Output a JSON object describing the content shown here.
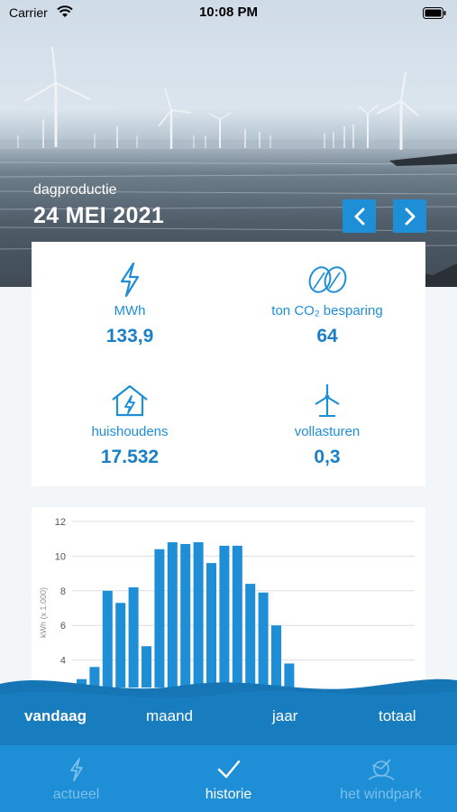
{
  "status_bar": {
    "carrier": "Carrier",
    "time": "10:08 PM"
  },
  "header": {
    "label": "dagproductie",
    "date": "24 MEI 2021"
  },
  "stats": [
    {
      "icon": "lightning-icon",
      "label": "MWh",
      "value": "133,9"
    },
    {
      "icon": "leaves-icon",
      "label": "ton CO₂ besparing",
      "value": "64"
    },
    {
      "icon": "house-icon",
      "label": "huishoudens",
      "value": "17.532"
    },
    {
      "icon": "wind-turbine-icon",
      "label": "vollasturen",
      "value": "0,3"
    }
  ],
  "chart_data": {
    "type": "bar",
    "ylabel": "kWh (x 1.000)",
    "ylim": [
      0,
      12
    ],
    "yticks": [
      4,
      6,
      8,
      10,
      12
    ],
    "values": [
      2.9,
      3.6,
      8.0,
      7.3,
      8.2,
      4.8,
      10.4,
      10.8,
      10.7,
      10.8,
      9.6,
      10.6,
      10.6,
      8.4,
      7.9,
      6.0,
      3.8,
      2.4
    ]
  },
  "period_tabs": [
    "vandaag",
    "maand",
    "jaar",
    "totaal"
  ],
  "bottom_nav": [
    {
      "icon": "lightning-icon",
      "label": "actueel"
    },
    {
      "icon": "checkmark-icon",
      "label": "historie"
    },
    {
      "icon": "windpark-icon",
      "label": "het windpark"
    }
  ],
  "colors": {
    "accent": "#1e8fd6",
    "wave": "#1676b5",
    "nav_bg": "#1e8fd6"
  }
}
